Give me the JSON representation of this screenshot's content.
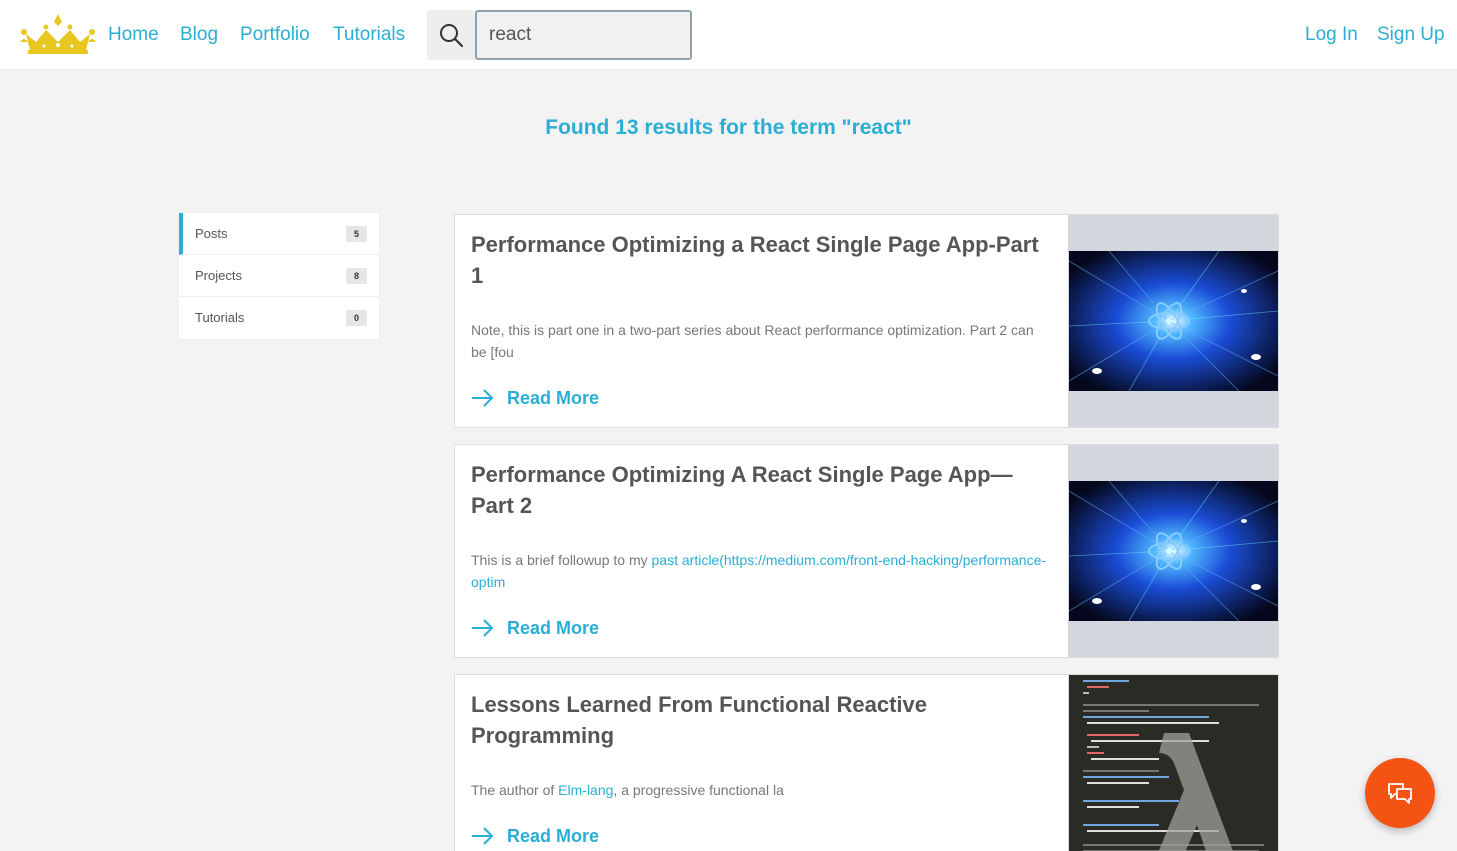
{
  "nav": {
    "links": [
      "Home",
      "Blog",
      "Portfolio",
      "Tutorials"
    ],
    "auth": [
      "Log In",
      "Sign Up"
    ]
  },
  "search": {
    "value": "react"
  },
  "results_heading": "Found 13 results for the term \"react\"",
  "sidebar": {
    "items": [
      {
        "label": "Posts",
        "count": "5",
        "active": true
      },
      {
        "label": "Projects",
        "count": "8",
        "active": false
      },
      {
        "label": "Tutorials",
        "count": "0",
        "active": false
      }
    ]
  },
  "results": [
    {
      "title": "Performance Optimizing a React Single Page App-Part 1",
      "excerpt": "Note, this is part one in a two-part series about React performance optimization. Part 2 can be [fou",
      "read_more": "Read More"
    },
    {
      "title": "Performance Optimizing A React Single Page App— Part 2",
      "excerpt_prefix": "This is a brief followup to my ",
      "excerpt_link": "past article(https://medium.com/front-end-hacking/performance-optim",
      "read_more": "Read More"
    },
    {
      "title": "Lessons Learned From Functional Reactive Programming",
      "excerpt_prefix": "The author of ",
      "excerpt_link": "Elm-lang",
      "excerpt_suffix": ", a progressive functional la",
      "read_more": "Read More"
    }
  ],
  "colors": {
    "accent": "#2aaed3",
    "chat": "#f55314",
    "logo": "#e8c820"
  }
}
